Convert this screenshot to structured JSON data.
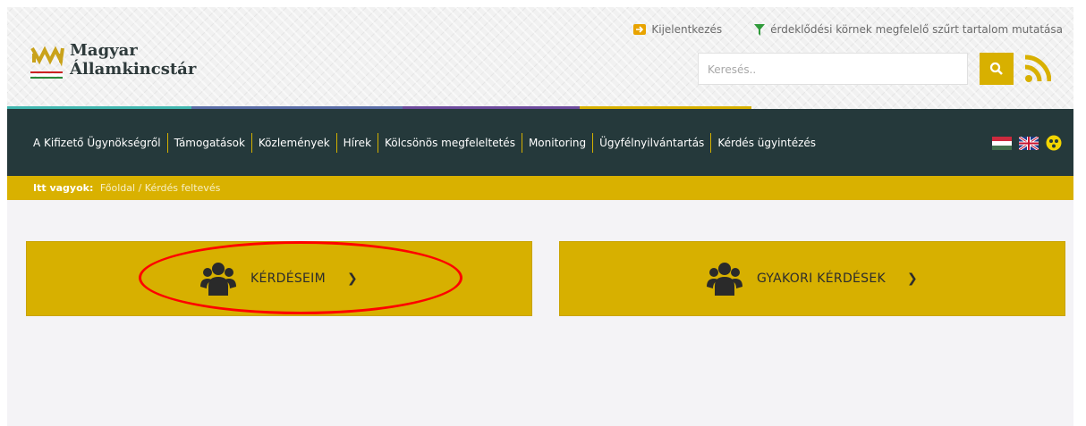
{
  "header": {
    "logo_line1": "Magyar",
    "logo_line2": "Államkincstár",
    "logout_label": "Kijelentkezés",
    "filter_label": "érdeklődési körnek megfelelő szűrt tartalom mutatása",
    "search_placeholder": "Keresés.."
  },
  "nav": {
    "items": [
      {
        "label": "A Kifizető Ügynökségről"
      },
      {
        "label": "Támogatások"
      },
      {
        "label": "Közlemények"
      },
      {
        "label": "Hírek"
      },
      {
        "label": "Kölcsönös megfeleltetés"
      },
      {
        "label": "Monitoring"
      },
      {
        "label": "Ügyfélnyilvántartás"
      },
      {
        "label": "Kérdés ügyintézés"
      }
    ]
  },
  "breadcrumb": {
    "prefix": "Itt vagyok:",
    "path": "Főoldal / Kérdés feltevés"
  },
  "cards": [
    {
      "label": "KÉRDÉSEIM",
      "icon": "users-icon"
    },
    {
      "label": "GYAKORI KÉRDÉSEK",
      "icon": "users-icon"
    }
  ],
  "colors": {
    "accent": "#d7b000",
    "nav_bg": "#25393b",
    "highlight": "#ff0000"
  }
}
